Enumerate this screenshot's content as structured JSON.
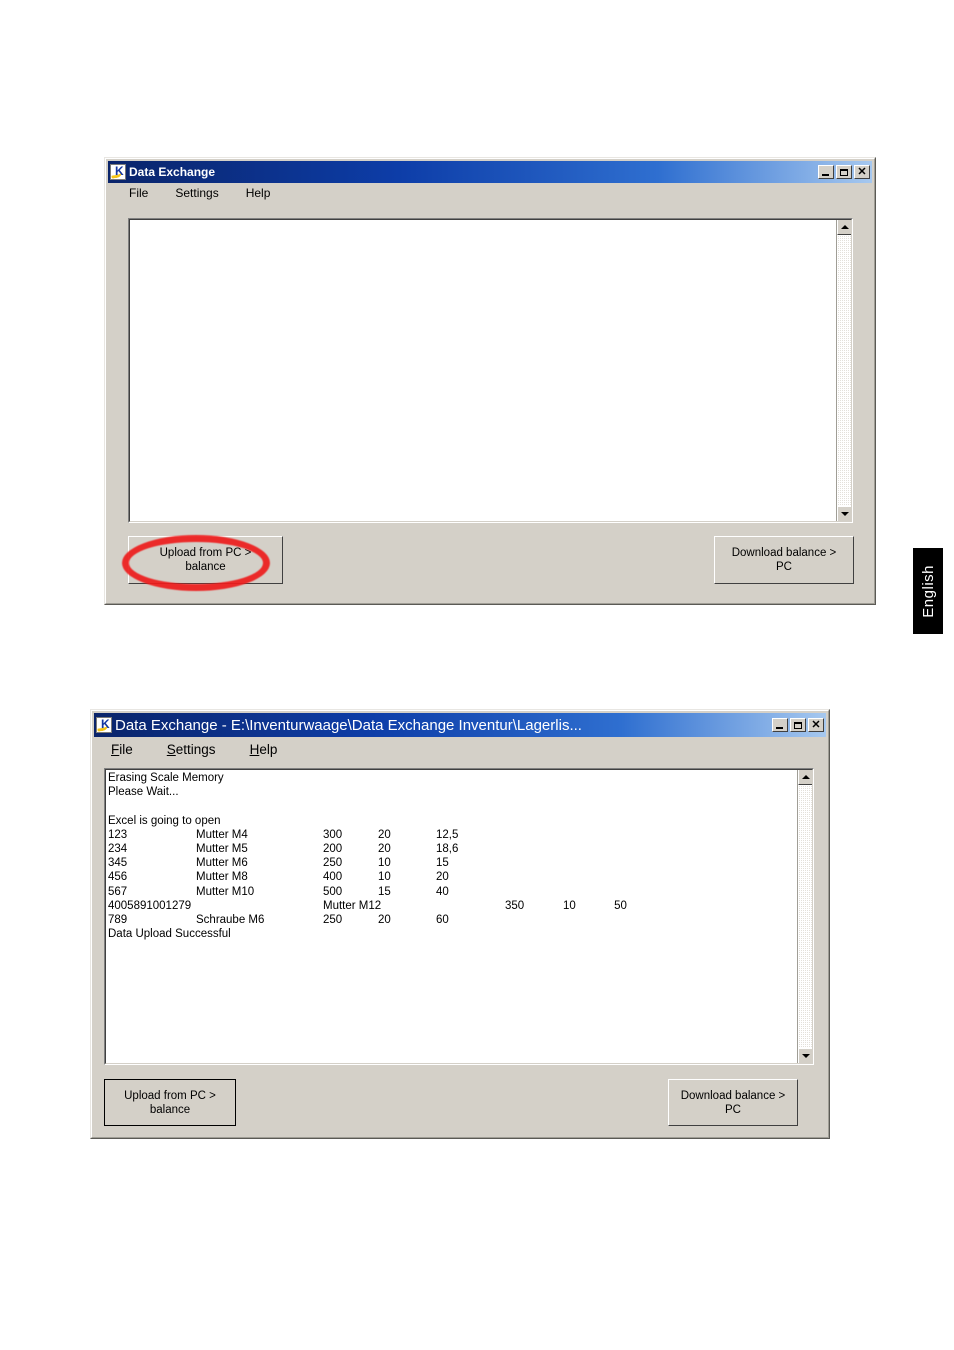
{
  "page": {
    "language_tab": "English"
  },
  "window1": {
    "title": "Data Exchange",
    "icon": "kern-k-logo-icon",
    "titlebar_buttons": [
      {
        "name": "minimize",
        "glyph": "_"
      },
      {
        "name": "maximize",
        "glyph": "□"
      },
      {
        "name": "close",
        "glyph": "×"
      }
    ],
    "menu": [
      {
        "label": "File",
        "accel": "F"
      },
      {
        "label": "Settings",
        "accel": "S"
      },
      {
        "label": "Help",
        "accel": "H"
      }
    ],
    "output_text": "",
    "buttons": {
      "upload": "Upload from PC >\nbalance",
      "download": "Download balance >\nPC"
    },
    "annotation": {
      "type": "ellipse",
      "color": "#ee1c1c",
      "targets": "upload-from-pc-button"
    }
  },
  "window2": {
    "title": "Data Exchange - E:\\Inventurwaage\\Data Exchange Inventur\\Lagerlis...",
    "icon": "kern-k-logo-icon",
    "titlebar_buttons": [
      {
        "name": "minimize",
        "glyph": "_"
      },
      {
        "name": "maximize",
        "glyph": "□"
      },
      {
        "name": "close",
        "glyph": "×"
      }
    ],
    "menu": [
      {
        "label": "File",
        "accel": "F"
      },
      {
        "label": "Settings",
        "accel": "S"
      },
      {
        "label": "Help",
        "accel": "H"
      }
    ],
    "log": {
      "lines": [
        "Erasing Scale Memory",
        "Please Wait...",
        "",
        "Excel is going to open"
      ],
      "footer": "Data Upload Successful"
    },
    "table": {
      "rows": [
        {
          "id": "123",
          "name": "Mutter M4",
          "v1": "300",
          "v2": "20",
          "v3": "12,5",
          "v4": ""
        },
        {
          "id": "234",
          "name": "Mutter M5",
          "v1": "200",
          "v2": "20",
          "v3": "18,6",
          "v4": ""
        },
        {
          "id": "345",
          "name": "Mutter M6",
          "v1": "250",
          "v2": "10",
          "v3": "15",
          "v4": ""
        },
        {
          "id": "456",
          "name": "Mutter M8",
          "v1": "400",
          "v2": "10",
          "v3": "20",
          "v4": ""
        },
        {
          "id": "567",
          "name": "Mutter M10",
          "v1": "500",
          "v2": "15",
          "v3": "40",
          "v4": ""
        },
        {
          "id": "4005891001279",
          "name": "Mutter M12",
          "v1": "",
          "v2": "350",
          "v3": "10",
          "v4": "50"
        },
        {
          "id": "789",
          "name": "Schraube M6",
          "v1": "250",
          "v2": "20",
          "v3": "60",
          "v4": ""
        }
      ]
    },
    "buttons": {
      "upload": "Upload from PC >\nbalance",
      "download": "Download balance >\nPC"
    }
  }
}
